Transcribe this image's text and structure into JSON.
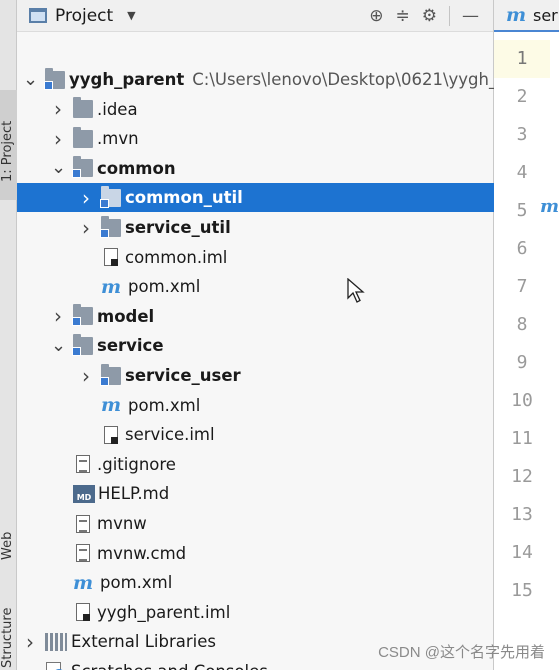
{
  "tool_strip": {
    "project_tab": "1: Project",
    "web_tab": "Web",
    "structure_tab": "Structure"
  },
  "panel": {
    "title": "Project"
  },
  "tree": [
    {
      "label": "yygh_parent",
      "path": "C:\\Users\\lenovo\\Desktop\\0621\\yygh_",
      "indent": 0,
      "chevron": "down",
      "icon": "module-folder",
      "bold": true,
      "selected": false
    },
    {
      "label": ".idea",
      "indent": 1,
      "chevron": "right",
      "icon": "folder",
      "bold": false,
      "selected": false
    },
    {
      "label": ".mvn",
      "indent": 1,
      "chevron": "right",
      "icon": "folder",
      "bold": false,
      "selected": false
    },
    {
      "label": "common",
      "indent": 1,
      "chevron": "down",
      "icon": "module-folder",
      "bold": true,
      "selected": false
    },
    {
      "label": "common_util",
      "indent": 2,
      "chevron": "right",
      "icon": "module-folder",
      "bold": true,
      "selected": true
    },
    {
      "label": "service_util",
      "indent": 2,
      "chevron": "right",
      "icon": "module-folder",
      "bold": true,
      "selected": false
    },
    {
      "label": "common.iml",
      "indent": 2,
      "chevron": "",
      "icon": "iml-file",
      "bold": false,
      "selected": false
    },
    {
      "label": "pom.xml",
      "indent": 2,
      "chevron": "",
      "icon": "maven-file",
      "bold": false,
      "selected": false
    },
    {
      "label": "model",
      "indent": 1,
      "chevron": "right",
      "icon": "module-folder",
      "bold": true,
      "selected": false
    },
    {
      "label": "service",
      "indent": 1,
      "chevron": "down",
      "icon": "module-folder",
      "bold": true,
      "selected": false
    },
    {
      "label": "service_user",
      "indent": 2,
      "chevron": "right",
      "icon": "module-folder",
      "bold": true,
      "selected": false
    },
    {
      "label": "pom.xml",
      "indent": 2,
      "chevron": "",
      "icon": "maven-file",
      "bold": false,
      "selected": false
    },
    {
      "label": "service.iml",
      "indent": 2,
      "chevron": "",
      "icon": "iml-file",
      "bold": false,
      "selected": false
    },
    {
      "label": ".gitignore",
      "indent": 1,
      "chevron": "",
      "icon": "text-file",
      "bold": false,
      "selected": false
    },
    {
      "label": "HELP.md",
      "indent": 1,
      "chevron": "",
      "icon": "md-file",
      "bold": false,
      "selected": false
    },
    {
      "label": "mvnw",
      "indent": 1,
      "chevron": "",
      "icon": "text-file",
      "bold": false,
      "selected": false
    },
    {
      "label": "mvnw.cmd",
      "indent": 1,
      "chevron": "",
      "icon": "text-file",
      "bold": false,
      "selected": false
    },
    {
      "label": "pom.xml",
      "indent": 1,
      "chevron": "",
      "icon": "maven-file",
      "bold": false,
      "selected": false
    },
    {
      "label": "yygh_parent.iml",
      "indent": 1,
      "chevron": "",
      "icon": "iml-file",
      "bold": false,
      "selected": false
    },
    {
      "label": "External Libraries",
      "indent": 0,
      "chevron": "right",
      "icon": "libraries",
      "bold": false,
      "selected": false
    },
    {
      "label": "Scratches and Consoles",
      "indent": 0,
      "chevron": "",
      "icon": "scratches",
      "bold": false,
      "selected": false
    }
  ],
  "editor": {
    "tab_label": "ser",
    "line_numbers": [
      "1",
      "2",
      "3",
      "4",
      "5",
      "6",
      "7",
      "8",
      "9",
      "10",
      "11",
      "12",
      "13",
      "14",
      "15"
    ],
    "current_line": "1"
  },
  "watermark": "CSDN @这个名字先用着",
  "colors": {
    "selection": "#1d73d1",
    "maven_icon": "#3e8fd6"
  }
}
